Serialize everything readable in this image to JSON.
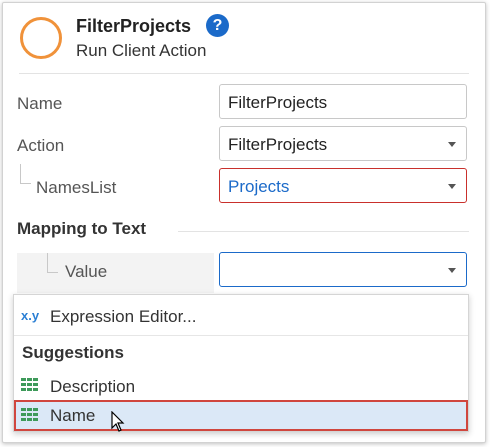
{
  "header": {
    "title": "FilterProjects",
    "subtitle": "Run Client Action",
    "help": "?"
  },
  "properties": {
    "name_label": "Name",
    "name_value": "FilterProjects",
    "action_label": "Action",
    "action_value": "FilterProjects",
    "nameslist_label": "NamesList",
    "nameslist_value": "Projects"
  },
  "mapping": {
    "title": "Mapping to Text",
    "value_label": "Value",
    "value_value": ""
  },
  "dropdown": {
    "expression_icon": "x.y",
    "expression_label": "Expression Editor...",
    "suggestions_header": "Suggestions",
    "items": [
      {
        "label": "Description",
        "icon": "table-icon"
      },
      {
        "label": "Name",
        "icon": "table-icon",
        "selected": true
      }
    ]
  },
  "colors": {
    "accent": "#1b6ac9",
    "ring": "#f0923a",
    "error_border": "#c9302c",
    "selection": "#dbe8f7"
  }
}
